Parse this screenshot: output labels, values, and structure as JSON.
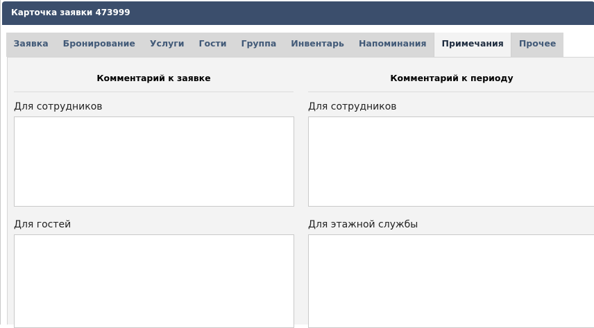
{
  "window": {
    "title": "Карточка заявки 473999"
  },
  "tabs": [
    {
      "label": "Заявка",
      "active": false
    },
    {
      "label": "Бронирование",
      "active": false
    },
    {
      "label": "Услуги",
      "active": false
    },
    {
      "label": "Гости",
      "active": false
    },
    {
      "label": "Группа",
      "active": false
    },
    {
      "label": "Инвентарь",
      "active": false
    },
    {
      "label": "Напоминания",
      "active": false
    },
    {
      "label": "Примечания",
      "active": true
    },
    {
      "label": "Прочее",
      "active": false
    }
  ],
  "left_column": {
    "heading": "Комментарий к заявке",
    "staff_label": "Для сотрудников",
    "staff_value": "",
    "guests_label": "Для гостей",
    "guests_value": ""
  },
  "right_column": {
    "heading": "Комментарий к периоду",
    "staff_label": "Для сотрудников",
    "staff_value": "",
    "housekeeping_label": "Для этажной службы",
    "housekeeping_value": ""
  },
  "colors": {
    "titlebar": "#3b4e6c",
    "tab_inactive": "#d8d8d8",
    "tab_active": "#f3f3f3",
    "tab_text": "#425a78",
    "panel_background": "#f3f3f3"
  }
}
